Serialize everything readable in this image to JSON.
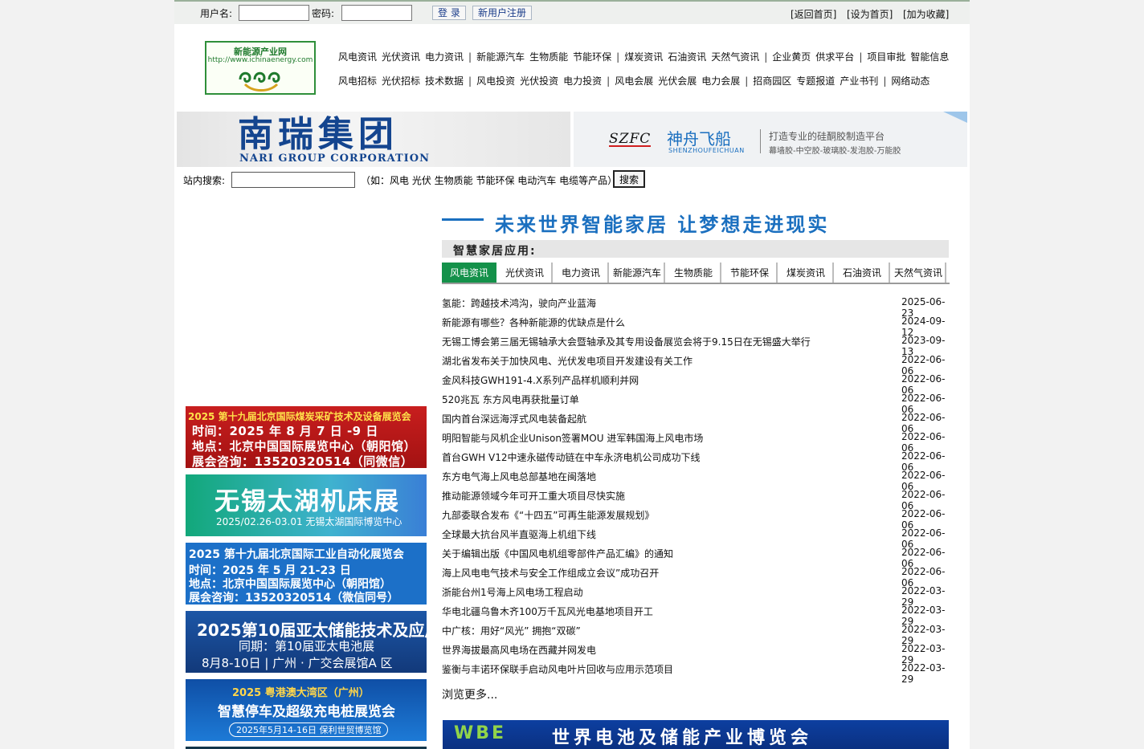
{
  "topbar": {
    "username_label": "用户名:",
    "password_label": "密码:",
    "login_button": "登 录",
    "register_button": "新用户注册",
    "links": [
      "[返回首页]",
      "[设为首页]",
      "[加为收藏]"
    ]
  },
  "logo": {
    "name": "新能源产业网",
    "url": "http://www.ichinaenergy.com"
  },
  "nav": {
    "row1": [
      "风电资讯",
      "光伏资讯",
      "电力资讯",
      "|",
      "新能源汽车",
      "生物质能",
      "节能环保",
      "|",
      "煤炭资讯",
      "石油资讯",
      "天然气资讯",
      "|",
      "企业黄页",
      "供求平台",
      "|",
      "项目审批",
      "智能信息"
    ],
    "row2": [
      "风电招标",
      "光伏招标",
      "技术数据",
      "|",
      "风电投资",
      "光伏投资",
      "电力投资",
      "|",
      "风电会展",
      "光伏会展",
      "电力会展",
      "|",
      "招商园区",
      "专题报道",
      "产业书刊",
      "|",
      "网络动态"
    ]
  },
  "banners": {
    "nari": {
      "title": "南瑞集团",
      "subtitle": "NARI GROUP CORPORATION"
    },
    "szfc": {
      "logo": "SZFC",
      "name": "神舟飞船",
      "pinyin": "SHENZHOUFEICHUAN",
      "tagline": "打造专业的硅酮胶制造平台",
      "products": "幕墙胶-中空胶-玻璃胶-发泡胶-万能胶"
    }
  },
  "site_search": {
    "label": "站内搜索:",
    "hint": "（如：风电 光伏 生物质能 节能环保 电动汽车 电缆等产品）",
    "button": "搜索",
    "value": ""
  },
  "ads": {
    "ad1": {
      "title": "2025 第十九届北京国际煤炭采矿技术及设备展览会",
      "lines": [
        "时间：2025 年 8 月 7 日 -9 日",
        "地点：北京中国国际展览中心（朝阳馆）",
        "展会咨询：13520320514（同微信）"
      ]
    },
    "ad2": {
      "title": "无锡太湖机床展",
      "sub": "2025/02.26-03.01   无锡太湖国际博览中心"
    },
    "ad3": {
      "lines": [
        "2025 第十九届北京国际工业自动化展览会",
        "时间：2025 年 5 月 21-23 日",
        "地点：北京中国国际展览中心（朝阳馆）",
        "展会咨询：13520320514（微信同号）"
      ]
    },
    "ad4": {
      "title": "2025第10届亚太储能技术及应用展",
      "lines": [
        "同期：第10届亚太电池展",
        "8月8-10日 | 广州 · 广交会展馆A 区"
      ]
    },
    "ad5": {
      "title": "2025 粤港澳大湾区（广州）",
      "main": "智慧停车及超级充电桩展览会",
      "sub": "2025年5月14-16日   保利世贸博览馆"
    }
  },
  "smart_home": {
    "headline": "未来世界智能家居 让梦想走进现实",
    "section_title": "智慧家居应用:"
  },
  "tabs": [
    "风电资讯",
    "光伏资讯",
    "电力资讯",
    "新能源汽车",
    "生物质能",
    "节能环保",
    "煤炭资讯",
    "石油资讯",
    "天然气资讯"
  ],
  "active_tab": "风电资讯",
  "news": [
    {
      "title": "氢能：跨越技术鸿沟，驶向产业蓝海",
      "date": "2025-06-23"
    },
    {
      "title": "新能源有哪些？各种新能源的优缺点是什么",
      "date": "2024-09-12"
    },
    {
      "title": "无锡工博会第三届无锡轴承大会暨轴承及其专用设备展览会将于9.15日在无锡盛大举行",
      "date": "2023-09-13"
    },
    {
      "title": "湖北省发布关于加快风电、光伏发电项目开发建设有关工作",
      "date": "2022-06-06"
    },
    {
      "title": "金风科技GWH191-4.X系列产品样机顺利并网",
      "date": "2022-06-06"
    },
    {
      "title": "520兆瓦 东方风电再获批量订单",
      "date": "2022-06-06"
    },
    {
      "title": "国内首台深远海浮式风电装备起航",
      "date": "2022-06-06"
    },
    {
      "title": "明阳智能与风机企业Unison签署MOU 进军韩国海上风电市场",
      "date": "2022-06-06"
    },
    {
      "title": "首台GWH V12中速永磁传动链在中车永济电机公司成功下线",
      "date": "2022-06-06"
    },
    {
      "title": "东方电气海上风电总部基地在闽落地",
      "date": "2022-06-06"
    },
    {
      "title": "推动能源领域今年可开工重大项目尽快实施",
      "date": "2022-06-06"
    },
    {
      "title": "九部委联合发布《“十四五”可再生能源发展规划》",
      "date": "2022-06-06"
    },
    {
      "title": "全球最大抗台风半直驱海上机组下线",
      "date": "2022-06-06"
    },
    {
      "title": "关于编辑出版《中国风电机组零部件产品汇编》的通知",
      "date": "2022-06-06"
    },
    {
      "title": "海上风电电气技术与安全工作组成立会议”成功召开",
      "date": "2022-06-06"
    },
    {
      "title": "浙能台州1号海上风电场工程启动",
      "date": "2022-03-29"
    },
    {
      "title": "华电北疆乌鲁木齐100万千瓦风光电基地项目开工",
      "date": "2022-03-29"
    },
    {
      "title": "中广核：用好“风光” 拥抱“双碳”",
      "date": "2022-03-29"
    },
    {
      "title": "世界海拔最高风电场在西藏并网发电",
      "date": "2022-03-29"
    },
    {
      "title": "鉴衡与丰诺环保联手启动风电叶片回收与应用示范项目",
      "date": "2022-03-29"
    }
  ],
  "more_link": "浏览更多...",
  "bottom_banner": {
    "logo": "WBE",
    "title": "世界电池及储能产业博览会"
  },
  "colors": {
    "accent_green": "#14914a",
    "link_blue": "#1a6fbf",
    "nari_blue": "#14458f"
  }
}
